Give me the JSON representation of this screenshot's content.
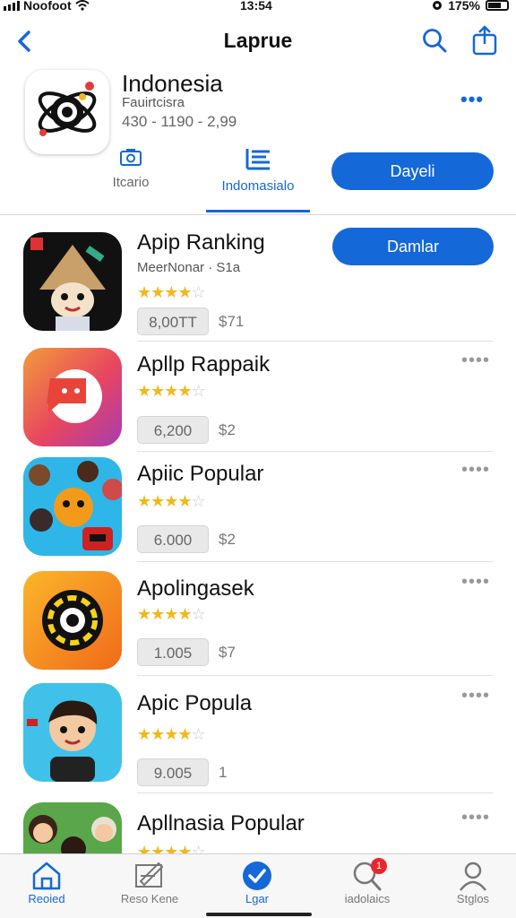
{
  "status_bar": {
    "carrier": "Noofoot",
    "time": "13:54",
    "battery": "175%"
  },
  "nav": {
    "title": "Laprue",
    "icons": [
      "chevron-left-icon",
      "search-icon",
      "share-icon"
    ]
  },
  "header_app": {
    "name": "Indonesia",
    "developer": "Fauirtcisra",
    "stats": "430 - 1190 - 2,99",
    "more": "•••"
  },
  "tabs": {
    "items": [
      {
        "label": "Itcario",
        "icon": "camera-icon"
      },
      {
        "label": "Indomasialo",
        "icon": "list-icon",
        "active": true
      }
    ],
    "action_label": "Dayeli"
  },
  "apps": [
    {
      "name": "Apip Ranking",
      "subtitle": "MeerNonar · S1a",
      "rating": 4.5,
      "count": "8,00TT",
      "price": "$71",
      "action": "Damlar",
      "icon": "scarecrow-icon"
    },
    {
      "name": "Apllp Rappaik",
      "subtitle": "",
      "rating": 3.5,
      "count": "6,200",
      "price": "$2",
      "more": "••••",
      "icon": "chat-bubble-icon"
    },
    {
      "name": "Apiic Popular",
      "subtitle": "",
      "rating": 4,
      "count": "6.000",
      "price": "$2",
      "more": "••••",
      "icon": "characters-icon"
    },
    {
      "name": "Apolingasek",
      "subtitle": "",
      "rating": 3.5,
      "count": "1.005",
      "price": "$7",
      "more": "••••",
      "icon": "target-icon"
    },
    {
      "name": "Apic Popula",
      "subtitle": "",
      "rating": 4,
      "count": "9.005",
      "price": "1",
      "more": "••••",
      "icon": "boy-icon"
    },
    {
      "name": "Apllnasia Popular",
      "subtitle": "",
      "rating": 3.5,
      "count": "",
      "price": "",
      "more": "••••",
      "icon": "family-icon"
    }
  ],
  "tab_bar": [
    {
      "label": "Reoied",
      "icon": "home-icon",
      "active": true
    },
    {
      "label": "Reso Kene",
      "icon": "edit-icon"
    },
    {
      "label": "Lgar",
      "icon": "check-circle-icon",
      "active": true
    },
    {
      "label": "iadolaics",
      "icon": "search-icon",
      "badge": "1"
    },
    {
      "label": "Stglos",
      "icon": "person-icon"
    }
  ],
  "colors": {
    "accent": "#1468d8",
    "star": "#f2b81b",
    "badge": "#e8262b"
  }
}
